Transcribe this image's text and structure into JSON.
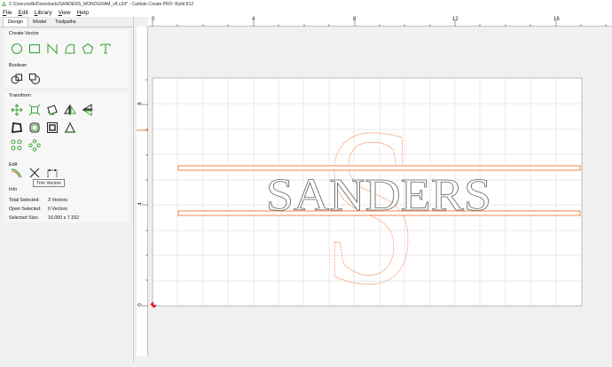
{
  "window": {
    "title": "C:/Users/wilb/Downloads/SANDERS_MONOGRAM_v8.c2d* - Carbide Create PRO: Build 812"
  },
  "menu": {
    "file": "File",
    "edit": "Edit",
    "library": "Library",
    "view": "View",
    "help": "Help"
  },
  "tabs": {
    "design": "Design",
    "model": "Model",
    "toolpaths": "Toolpaths"
  },
  "sections": {
    "create_vector": "Create Vector",
    "boolean": "Boolean",
    "transform": "Transform",
    "edit": "Edit",
    "info": "Info"
  },
  "tooltip": "Trim Vectors",
  "info": {
    "total_selected_label": "Total Selected:",
    "total_selected_value": "3 Vectors",
    "open_selected_label": "Open Selected:",
    "open_selected_value": "0 Vectors",
    "selected_size_label": "Selected Size:",
    "selected_size_value": "16.000 x 7.332"
  },
  "ruler": {
    "x_ticks": [
      "0",
      "4",
      "8",
      "12",
      "16"
    ],
    "y_ticks": [
      "8",
      "4",
      "0"
    ]
  },
  "design": {
    "text": "SANDERS",
    "monogram_letter": "S"
  },
  "colors": {
    "icon_green": "#3aa63a",
    "selection_orange": "#f07a3a",
    "grid_line": "#d4d4d4"
  }
}
